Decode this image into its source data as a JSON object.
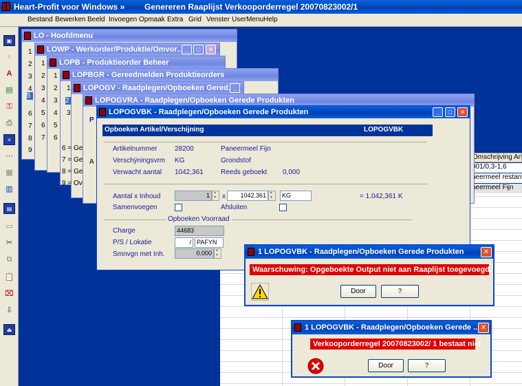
{
  "app": {
    "title": "Heart-Profit voor Windows  »",
    "document_title": "Genereren Raaplijst Verkooporderregel 20070823002/1"
  },
  "menu": [
    "Bestand",
    "Bewerken",
    "Beeld",
    "Invoegen",
    "Opmaak",
    "Extra",
    "Grid",
    "Venster",
    "UserMenu",
    "Help"
  ],
  "windows": {
    "lo": "LO - Hoofdmenu",
    "lowp": "LOWP - Werkorder/Produktie/Omvor...",
    "lopb": "LOPB - Produktieorder Beheer",
    "lopbgr": "LOPBGR - Gereedmelden Produktieorders",
    "lopogv": "LOPOGV - Raadplegen/Opboeken Gered...",
    "lopogvra": "LOPOGVRA - Raadplegen/Opboeken Gerede Produkten",
    "lopogvbk": "LOPOGVBK - Raadplegen/Opboeken Gerede Produkten"
  },
  "menu_numbers": [
    "1",
    "2",
    "3",
    "4",
    "5",
    "6",
    "7",
    "8",
    "9"
  ],
  "lopogvbk_list": [
    "6 = Ge",
    "7 = Ge",
    "8 = Ge",
    "9 = Ov"
  ],
  "stray_letters": {
    "a": "A",
    "p": "P",
    "a2": "A"
  },
  "grid": {
    "header": "Omschrijving Artik",
    "rows": [
      "001/0,3-1,6",
      "neermeel restanten",
      "neermeel Fijn"
    ]
  },
  "form": {
    "header_left": "Opboeken Artikel/Verschijning",
    "header_right": "LOPOGVBK",
    "artikelnummer_label": "Artikelnummer",
    "artikelnummer": "28200",
    "artikel_desc": "Paneermeel Fijn",
    "verschijningsvrm_label": "Verschÿningsvrm",
    "verschijningsvrm": "KG",
    "grondstof": "Grondstof",
    "verwacht_label": "Verwacht aantal",
    "verwacht": "1042,361",
    "geboekt_label": "Reeds geboekt",
    "geboekt": "0,000",
    "aantal_label": "Aantal x Inhoud",
    "aantal": "1",
    "x": "x",
    "inhoud": "1042.361",
    "eenheid": "KG",
    "resultaat": "= 1.042,361 K",
    "samenvoegen_label": "Samenvoegen",
    "afsluiten_label": "Afsluiten",
    "voorraad_title": "Opboeken Voorraad",
    "charge_label": "Charge",
    "charge": "44683",
    "ps_label": "P/S / Lokatie",
    "ps": "/",
    "lokatie": "PAFYN",
    "smnvgn_label": "Smnvgn met Inh.",
    "smnvgn": "0.000"
  },
  "dialog1": {
    "title": "1 LOPOGVBK - Raadplegen/Opboeken Gerede Produkten",
    "message": "Waarschuwing: Opgeboekte Output niet aan Raaplijst toegevoegd;",
    "ok_label": "Door",
    "help_label": "?"
  },
  "dialog2": {
    "title": "1 LOPOGVBK - Raadplegen/Opboeken Gerede ...",
    "message": "Verkooporderregel 20070823002/  1 bestaat niet",
    "ok_label": "Door",
    "help_label": "?"
  },
  "colors": {
    "titlebar": "#0a5fdc",
    "inactive_title": "#7b8fe6",
    "error": "#e00000",
    "workspace": "#003399"
  }
}
